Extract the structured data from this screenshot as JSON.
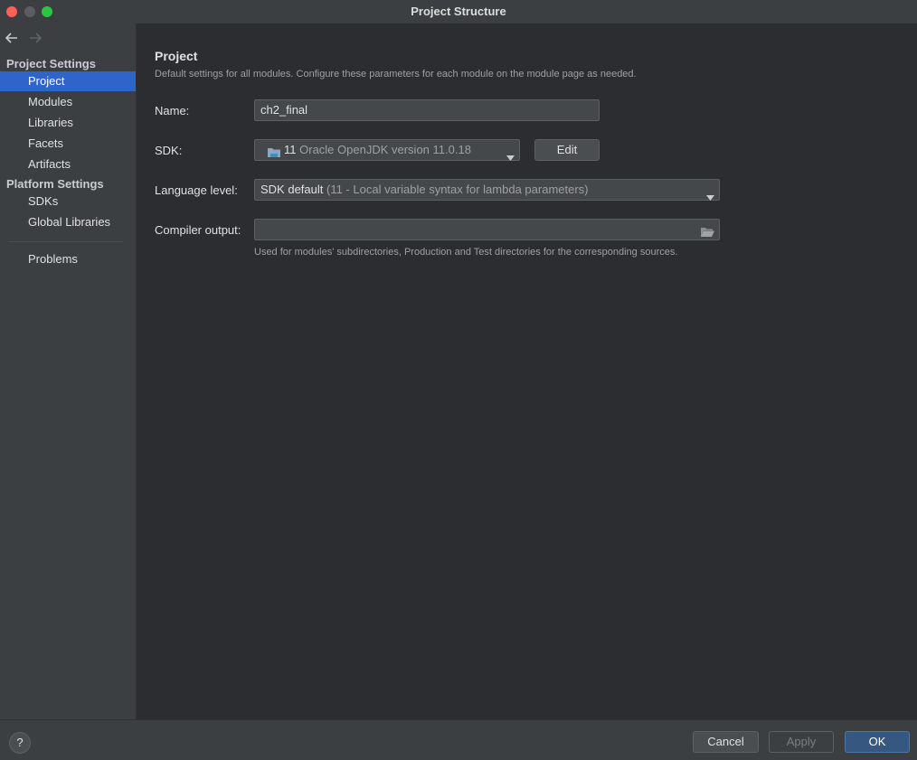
{
  "window": {
    "title": "Project Structure"
  },
  "sidebar": {
    "project_settings_header": "Project Settings",
    "platform_settings_header": "Platform Settings",
    "items": [
      {
        "label": "Project"
      },
      {
        "label": "Modules"
      },
      {
        "label": "Libraries"
      },
      {
        "label": "Facets"
      },
      {
        "label": "Artifacts"
      },
      {
        "label": "SDKs"
      },
      {
        "label": "Global Libraries"
      },
      {
        "label": "Problems"
      }
    ]
  },
  "content": {
    "title": "Project",
    "description": "Default settings for all modules. Configure these parameters for each module on the module page as needed.",
    "name": {
      "label": "Name:",
      "value": "ch2_final"
    },
    "sdk": {
      "label": "SDK:",
      "version": "11",
      "name": "Oracle OpenJDK version 11.0.18",
      "edit_label": "Edit"
    },
    "language_level": {
      "label": "Language level:",
      "value": "SDK default",
      "detail": "(11 - Local variable syntax for lambda parameters)"
    },
    "compiler_output": {
      "label": "Compiler output:",
      "value": "",
      "hint": "Used for modules' subdirectories, Production and Test directories for the corresponding sources."
    }
  },
  "footer": {
    "help_label": "?",
    "cancel_label": "Cancel",
    "apply_label": "Apply",
    "ok_label": "OK"
  },
  "colors": {
    "selection": "#2f65ca",
    "ok_button": "#365880",
    "background": "#2b2d30",
    "panel": "#3c3f41"
  }
}
